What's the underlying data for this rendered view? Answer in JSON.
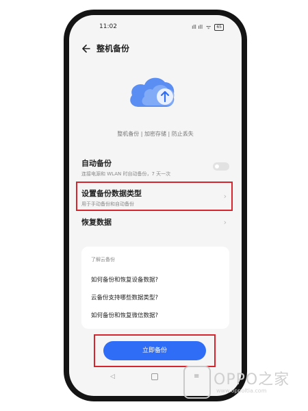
{
  "status_bar": {
    "time": "11:02",
    "signal": "ıll ıll",
    "wifi": "ᯤ",
    "battery": "65"
  },
  "header": {
    "title": "整机备份"
  },
  "hero": {
    "tagline": "整机备份 | 加密存储 | 防止丢失"
  },
  "settings": {
    "auto_backup": {
      "title": "自动备份",
      "subtitle": "连接电源和 WLAN 时自动备份，7 天一次"
    },
    "data_type": {
      "title": "设置备份数据类型",
      "subtitle": "用于手动备份和自动备份"
    },
    "restore": {
      "title": "恢复数据"
    }
  },
  "faq": {
    "heading": "了解云备份",
    "items": [
      "如何备份和恢复设备数据?",
      "云备份支持哪些数据类型?",
      "如何备份和恢复微信数据?"
    ]
  },
  "actions": {
    "backup_now": "立即备份"
  },
  "watermark": {
    "brand": "OPPO之家",
    "url": "www.oppoltia.com"
  },
  "colors": {
    "accent": "#2f6df6",
    "highlight": "#d6252d"
  }
}
